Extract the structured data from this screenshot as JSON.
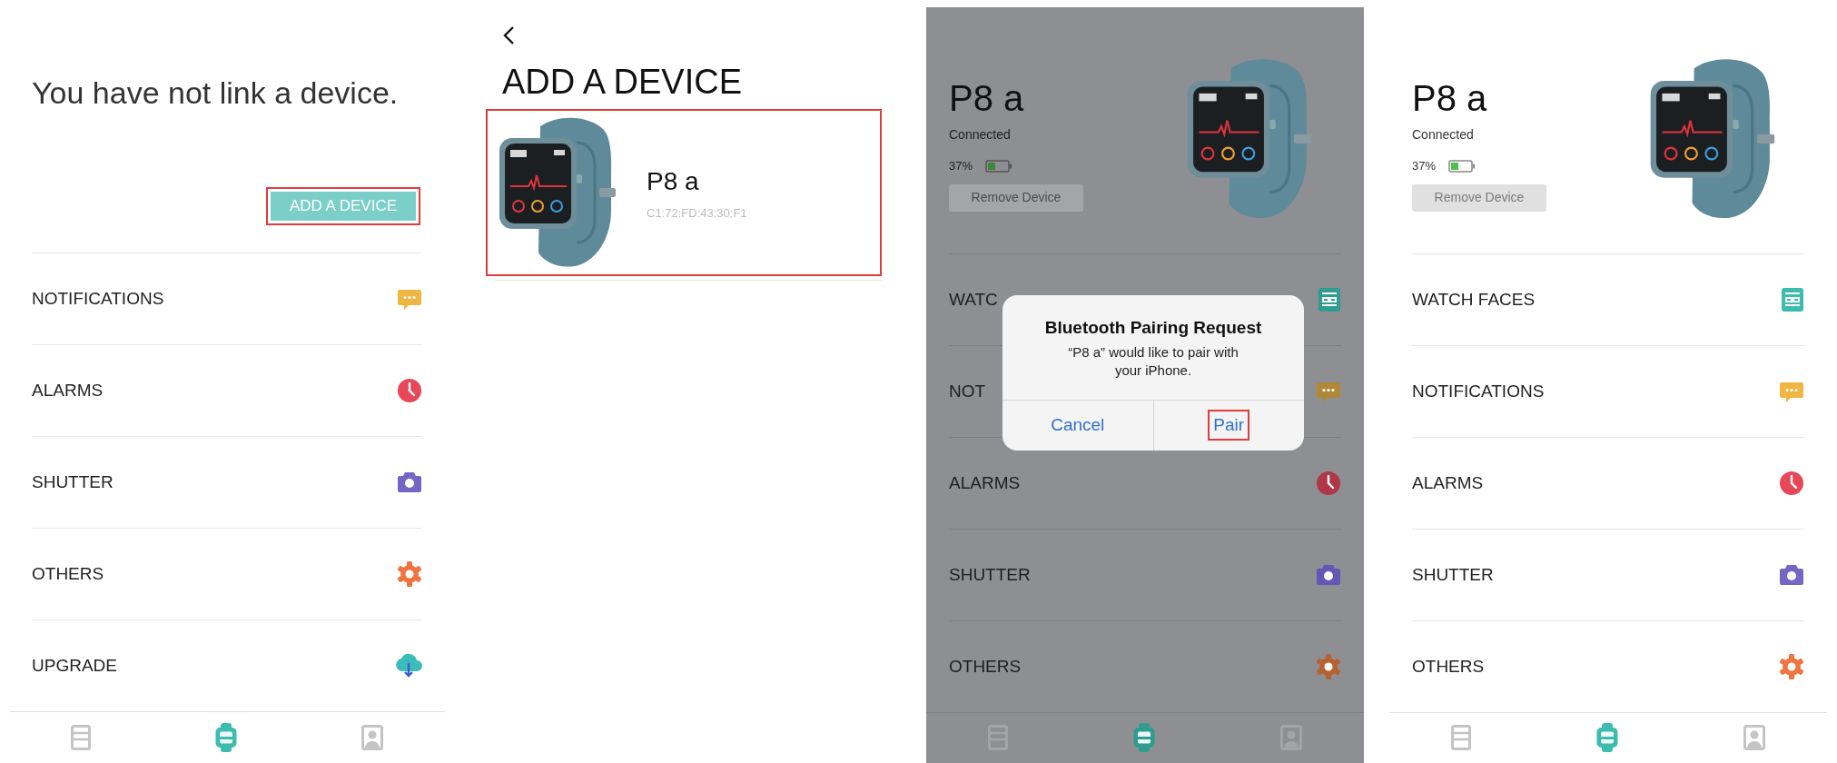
{
  "screens": [
    {
      "kind": "empty",
      "title": "You have not link a device.",
      "button": {
        "label": "ADD A DEVICE",
        "highlighted": true
      },
      "menu": [
        {
          "label": "NOTIFICATIONS",
          "kind": "notifications",
          "color": "#f0b542"
        },
        {
          "label": "ALARMS",
          "kind": "alarms",
          "color": "#e8475a"
        },
        {
          "label": "SHUTTER",
          "kind": "shutter",
          "color": "#7565c4"
        },
        {
          "label": "OTHERS",
          "kind": "others",
          "color": "#ef7440"
        },
        {
          "label": "UPGRADE",
          "kind": "upgrade",
          "color": "#3cbcb9"
        }
      ],
      "tabs": [
        {
          "kind": "cards",
          "selected": false
        },
        {
          "kind": "watch",
          "selected": true
        },
        {
          "kind": "profile",
          "selected": false
        }
      ]
    },
    {
      "kind": "add",
      "title": "ADD A DEVICE",
      "devices": [
        {
          "name": "P8 a",
          "address": "C1:72:FD:43:30:F1",
          "highlighted": true
        }
      ]
    },
    {
      "kind": "device",
      "dimmed": true,
      "name": "P8 a",
      "status": "Connected",
      "battery": "37%",
      "remove_button": {
        "label": "Remove Device",
        "disabled": true
      },
      "menu": [
        {
          "label": "WATC",
          "kind": "watch_faces",
          "color": "#2f9c90"
        },
        {
          "label": "NOT",
          "kind": "notifications",
          "color": "#b08838"
        },
        {
          "label": "ALARMS",
          "kind": "alarms",
          "color": "#b03748"
        },
        {
          "label": "SHUTTER",
          "kind": "shutter",
          "color": "#6555b5"
        },
        {
          "label": "OTHERS",
          "kind": "others",
          "color": "#b8602f"
        }
      ],
      "tabs": [
        {
          "kind": "cards",
          "selected": false
        },
        {
          "kind": "watch",
          "selected": true
        },
        {
          "kind": "profile",
          "selected": false
        }
      ],
      "dialog": {
        "title": "Bluetooth Pairing Request",
        "message": "“P8 a” would like to pair with your iPhone.",
        "buttons": [
          {
            "label": "Cancel",
            "highlighted": false
          },
          {
            "label": "Pair",
            "highlighted": true
          }
        ]
      }
    },
    {
      "kind": "device",
      "dimmed": false,
      "name": "P8 a",
      "status": "Connected",
      "battery": "37%",
      "remove_button": {
        "label": "Remove Device",
        "disabled": true
      },
      "menu": [
        {
          "label": "WATCH FACES",
          "kind": "watch_faces",
          "color": "#3cbcae"
        },
        {
          "label": "NOTIFICATIONS",
          "kind": "notifications",
          "color": "#f0b542"
        },
        {
          "label": "ALARMS",
          "kind": "alarms",
          "color": "#e8475a"
        },
        {
          "label": "SHUTTER",
          "kind": "shutter",
          "color": "#7565c4"
        },
        {
          "label": "OTHERS",
          "kind": "others",
          "color": "#ef7440"
        }
      ],
      "tabs": [
        {
          "kind": "cards",
          "selected": false
        },
        {
          "kind": "watch",
          "selected": true
        },
        {
          "kind": "profile",
          "selected": false
        }
      ]
    }
  ]
}
